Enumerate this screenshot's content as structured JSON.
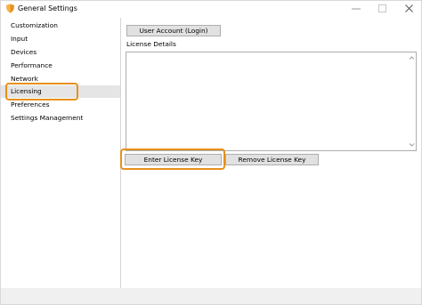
{
  "window": {
    "title": "General Settings",
    "app_icon": "shield-icon",
    "controls": {
      "minimize": "minimize-icon",
      "maximize": "maximize-icon",
      "close": "close-icon"
    }
  },
  "sidebar": {
    "items": [
      {
        "label": "Customization",
        "selected": false
      },
      {
        "label": "Input",
        "selected": false
      },
      {
        "label": "Devices",
        "selected": false
      },
      {
        "label": "Performance",
        "selected": false
      },
      {
        "label": "Network",
        "selected": false
      },
      {
        "label": "Licensing",
        "selected": true
      },
      {
        "label": "Preferences",
        "selected": false
      },
      {
        "label": "Settings Management",
        "selected": false
      }
    ]
  },
  "main": {
    "user_account_button": "User Account (Login)",
    "license_details_label": "License Details",
    "license_details_value": "",
    "enter_license_key_button": "Enter License Key",
    "remove_license_key_button": "Remove License Key"
  },
  "colors": {
    "highlight": "#e8901b",
    "selected_item_bg": "#e5e5e5",
    "button_bg": "#e1e1e1",
    "app_icon": "#e8901b"
  }
}
